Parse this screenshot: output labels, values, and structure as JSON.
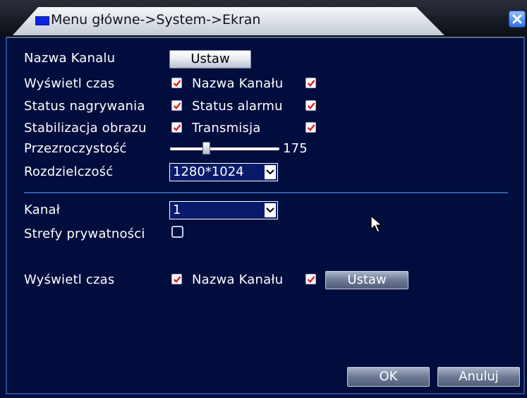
{
  "window": {
    "title": "Menu główne->System->Ekran"
  },
  "rows": {
    "channel_name": {
      "label": "Nazwa Kanalu",
      "button": "Ustaw"
    },
    "show_time": {
      "label": "Wyświetl czas",
      "checked": true,
      "pair_label": "Nazwa Kanału",
      "pair_checked": true
    },
    "record_status": {
      "label": "Status nagrywania",
      "checked": true,
      "pair_label": "Status alarmu",
      "pair_checked": true
    },
    "stabilization": {
      "label": "Stabilizacja obrazu",
      "checked": true,
      "pair_label": "Transmisja",
      "pair_checked": true
    },
    "transparency": {
      "label": "Przezroczystość",
      "value": "175",
      "level": 175,
      "max": 255
    },
    "resolution": {
      "label": "Rozdzielczość",
      "value": "1280*1024"
    }
  },
  "channel_section": {
    "channel": {
      "label": "Kanał",
      "value": "1"
    },
    "privacy": {
      "label": "Strefy prywatności",
      "checked": false
    },
    "show_time": {
      "label": "Wyświetl czas",
      "checked": true,
      "pair_label": "Nazwa Kanału",
      "pair_checked": true,
      "button": "Ustaw"
    }
  },
  "footer": {
    "ok": "OK",
    "cancel": "Anuluj"
  },
  "colors": {
    "background": "#010d3d",
    "check": "#d81f1f",
    "accent": "#2e5ca8"
  }
}
